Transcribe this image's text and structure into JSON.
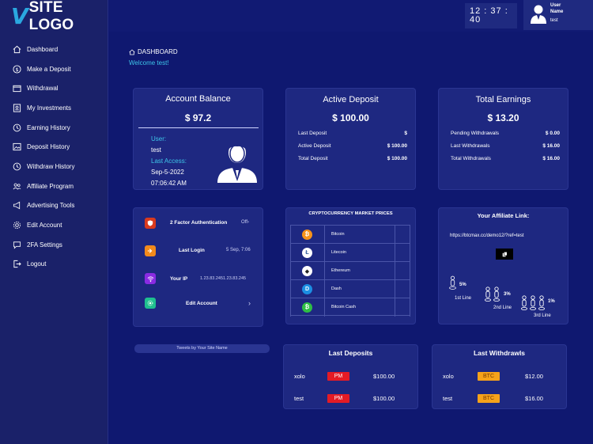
{
  "logo": {
    "mark": "V",
    "text": "SITE LOGO"
  },
  "sidebar": {
    "items": [
      {
        "label": "Dashboard",
        "icon": "home-icon"
      },
      {
        "label": "Make a Deposit",
        "icon": "dollar-icon"
      },
      {
        "label": "Withdrawal",
        "icon": "wallet-icon"
      },
      {
        "label": "My Investments",
        "icon": "investment-icon"
      },
      {
        "label": "Earning History",
        "icon": "history-icon"
      },
      {
        "label": "Deposit History",
        "icon": "image-icon"
      },
      {
        "label": "Withdraw History",
        "icon": "history-icon"
      },
      {
        "label": "Affiliate Program",
        "icon": "users-icon"
      },
      {
        "label": "Advertising Tools",
        "icon": "megaphone-icon"
      },
      {
        "label": "Edit Account",
        "icon": "gear-icon"
      },
      {
        "label": "2FA Settings",
        "icon": "chat-icon"
      },
      {
        "label": "Logout",
        "icon": "logout-icon"
      }
    ]
  },
  "header": {
    "clock": "12 : 37 : 40",
    "user_label": "User Name",
    "user_line1": "User",
    "user_line2": "Name",
    "username": "test"
  },
  "breadcrumb": "DASHBOARD",
  "welcome": "Welcome test!",
  "account": {
    "title": "Account Balance",
    "amount": "$ 97.2",
    "user_label": "User:",
    "user_value": "test",
    "last_access_label": "Last Access:",
    "last_access_date": "Sep-5-2022",
    "last_access_time": "07:06:42 AM"
  },
  "active_deposit": {
    "title": "Active Deposit",
    "amount": "$ 100.00",
    "rows": [
      {
        "label": "Last Deposit",
        "value": "$"
      },
      {
        "label": "Active Deposit",
        "value": "$ 100.00"
      },
      {
        "label": "Total Deposit",
        "value": "$ 100.00"
      }
    ]
  },
  "earnings": {
    "title": "Total Earnings",
    "amount": "$ 13.20",
    "rows": [
      {
        "label": "Pending Withdrawals",
        "value": "$ 0.00"
      },
      {
        "label": "Last Withdrawals",
        "value": "$ 16.00"
      },
      {
        "label": "Total Withdrawals",
        "value": "$ 16.00"
      }
    ]
  },
  "security": {
    "rows": [
      {
        "label": "2 Factor Authentication",
        "value": "Off",
        "color": "#d93a1e",
        "icon": "shield-icon"
      },
      {
        "label": "Last Login",
        "value": "5 Sep, 7:06",
        "color": "#f28a1c",
        "icon": "login-icon"
      },
      {
        "label": "Your IP",
        "value": "1.23.83.2451.23.83.245",
        "color": "#8a2be2",
        "icon": "wifi-icon"
      },
      {
        "label": "Edit Account",
        "value": "",
        "color": "#1fbf8f",
        "icon": "gear-icon"
      }
    ]
  },
  "crypto": {
    "title": "CRYPTOCURRENCY MARKET PRICES",
    "coins": [
      {
        "name": "Bitcoin",
        "color": "#f7931a",
        "glyph": "₿"
      },
      {
        "name": "Litecoin",
        "color": "#ffffff",
        "glyph": "Ł"
      },
      {
        "name": "Ethereum",
        "color": "#ffffff",
        "glyph": "◆"
      },
      {
        "name": "Dash",
        "color": "#1c8fe3",
        "glyph": "D"
      },
      {
        "name": "Bitcoin Cash",
        "color": "#2fbf45",
        "glyph": "₿"
      }
    ]
  },
  "affiliate": {
    "title": "Your Affiliate Link:",
    "link": "https://btcmax.cc/demo12/?ref=test",
    "levels": [
      {
        "pct": "5%",
        "label": "1st Line"
      },
      {
        "pct": "3%",
        "label": "2nd Line"
      },
      {
        "pct": "1%",
        "label": "3rd Line"
      }
    ]
  },
  "tweets": "Tweets by Your Site Name",
  "last_deposits": {
    "title": "Last Deposits",
    "rows": [
      {
        "user": "xolo",
        "method": "PM",
        "amount": "$100.00"
      },
      {
        "user": "test",
        "method": "PM",
        "amount": "$100.00"
      }
    ]
  },
  "last_withdrawals": {
    "title": "Last Withdrawls",
    "rows": [
      {
        "user": "xolo",
        "method": "BTC",
        "amount": "$12.00"
      },
      {
        "user": "test",
        "method": "BTC",
        "amount": "$16.00"
      }
    ]
  }
}
